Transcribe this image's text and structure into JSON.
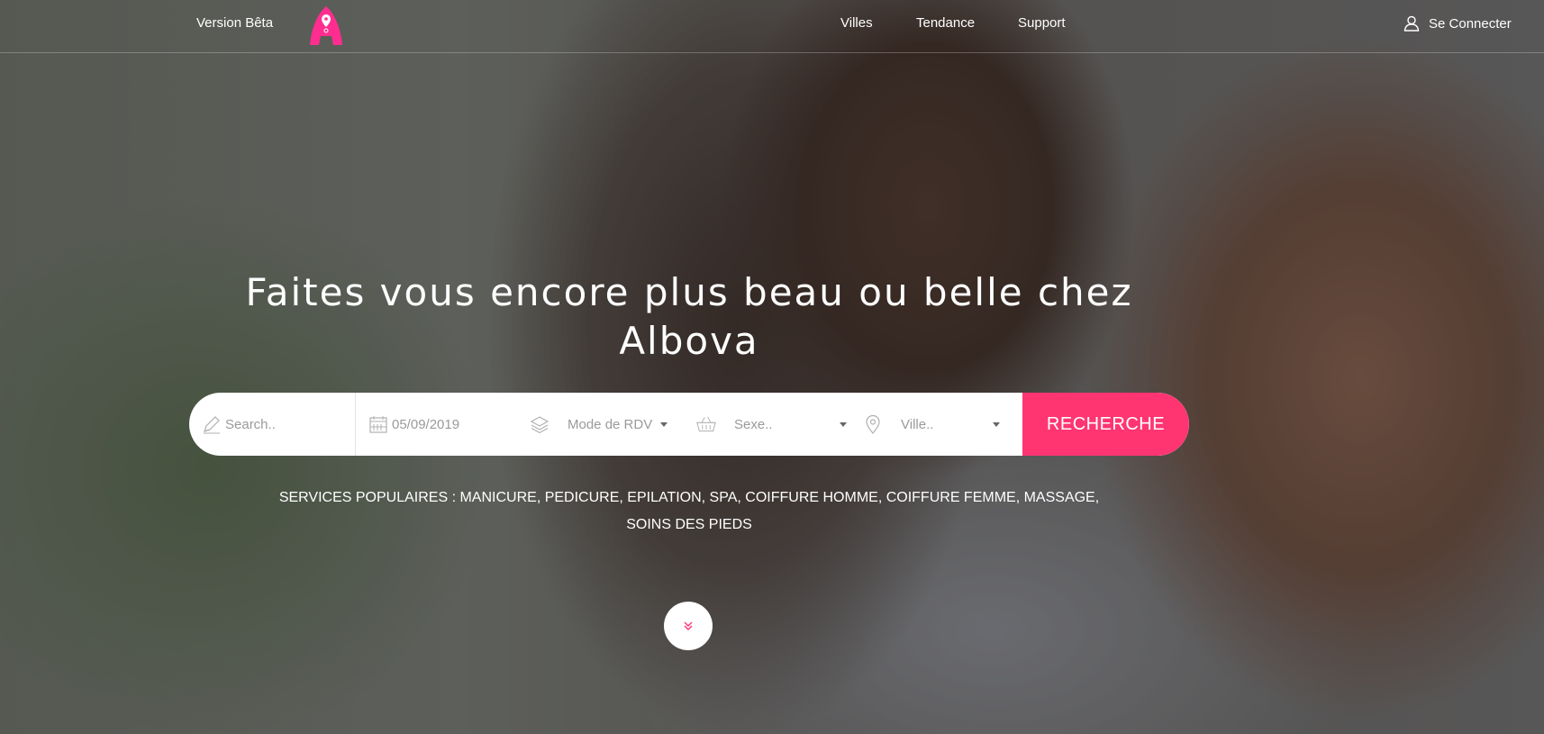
{
  "header": {
    "beta_label": "Version Bêta",
    "logo_icon": "albova-pin-logo",
    "nav": [
      "Villes",
      "Tendance",
      "Support"
    ],
    "login_label": "Se Connecter",
    "login_icon": "user-icon"
  },
  "hero": {
    "headline_line1": "Faites vous encore plus beau ou belle chez",
    "headline_line2": "Albova"
  },
  "search": {
    "search_placeholder": "Search..",
    "date_value": "05/09/2019",
    "mode_placeholder": "Mode de RDV",
    "sexe_placeholder": "Sexe..",
    "ville_placeholder": "Ville..",
    "button_label": "RECHERCHE"
  },
  "popular": {
    "line1": "SERVICES POPULAIRES : MANICURE, PEDICURE, EPILATION, SPA, COIFFURE HOMME, COIFFURE FEMME, MASSAGE,",
    "line2": "SOINS DES PIEDS"
  },
  "colors": {
    "accent": "#ff3572",
    "logo_pink": "#ff2d8f"
  }
}
